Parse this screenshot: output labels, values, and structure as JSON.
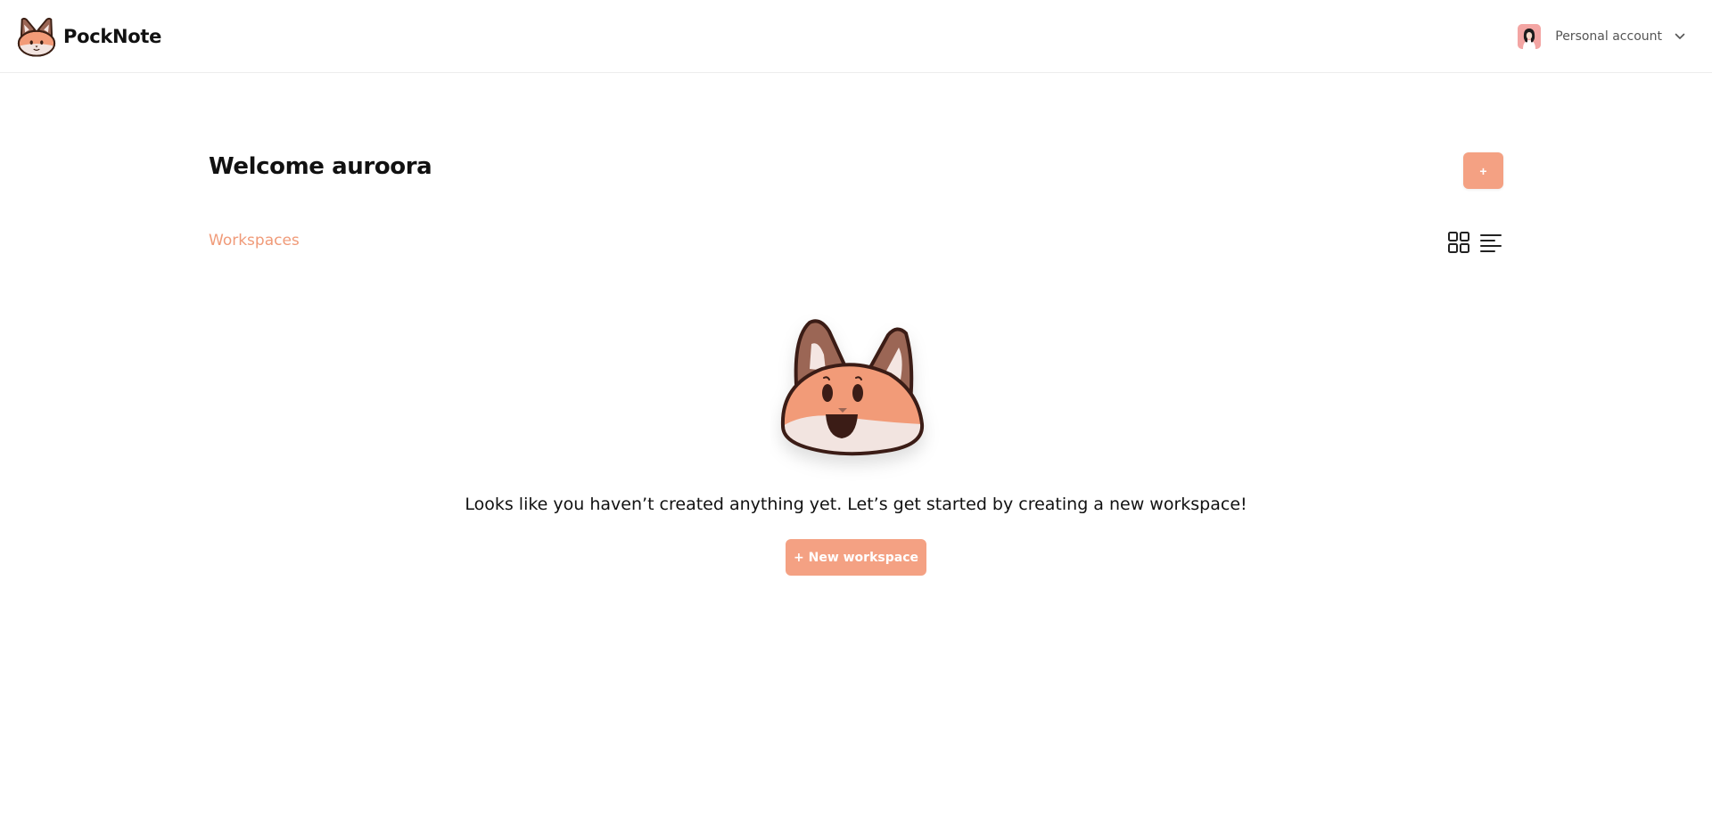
{
  "header": {
    "app_name": "PockNote",
    "logo_icon": "fox-logo-icon",
    "account": {
      "label": "Personal account",
      "avatar_icon": "user-avatar",
      "dropdown_icon": "chevron-down-icon"
    }
  },
  "main": {
    "welcome_title": "Welcome auroora",
    "add_button_label": "+",
    "section_label": "Workspaces",
    "view_toggle": {
      "grid_icon": "grid-view-icon",
      "list_icon": "list-view-icon"
    },
    "empty_state": {
      "illustration": "fox-mascot",
      "message": "Looks like you haven’t created anything yet. Let’s get started by creating a new workspace!",
      "button_label": "+ New workspace"
    }
  },
  "colors": {
    "accent": "#f4a183",
    "accent_text": "#f09a78",
    "fox_orange": "#f29b78",
    "fox_brown": "#9b6655",
    "fox_outline": "#3b1f14"
  }
}
